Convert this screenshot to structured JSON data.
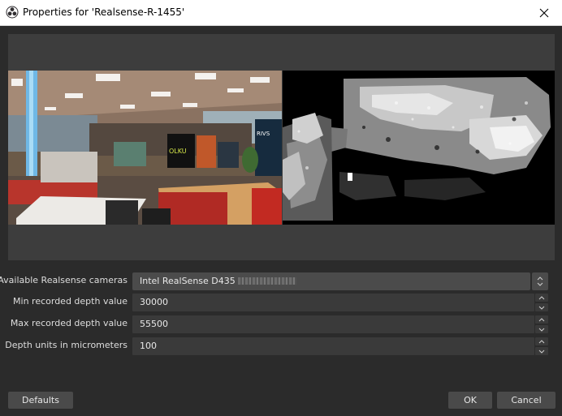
{
  "window": {
    "title": "Properties for 'Realsense-R-1455'",
    "app_icon": "obs-logo-icon",
    "close_icon": "close-icon"
  },
  "preview": {
    "left_stream": "color camera image",
    "right_stream": "depth map image"
  },
  "properties": [
    {
      "label": "Available Realsense cameras",
      "type": "combo",
      "value": "Intel RealSense D435"
    },
    {
      "label": "Min recorded depth value",
      "type": "spin",
      "value": "30000"
    },
    {
      "label": "Max recorded depth value",
      "type": "spin",
      "value": "55500"
    },
    {
      "label": "Depth units in micrometers",
      "type": "spin",
      "value": "100"
    }
  ],
  "buttons": {
    "defaults": "Defaults",
    "ok": "OK",
    "cancel": "Cancel"
  },
  "colors": {
    "background": "#2b2b2b",
    "preview_bg": "#3d3d3d",
    "input_bg": "#3a3a3a",
    "button_bg": "#4a4a4a",
    "text": "#dedede"
  }
}
